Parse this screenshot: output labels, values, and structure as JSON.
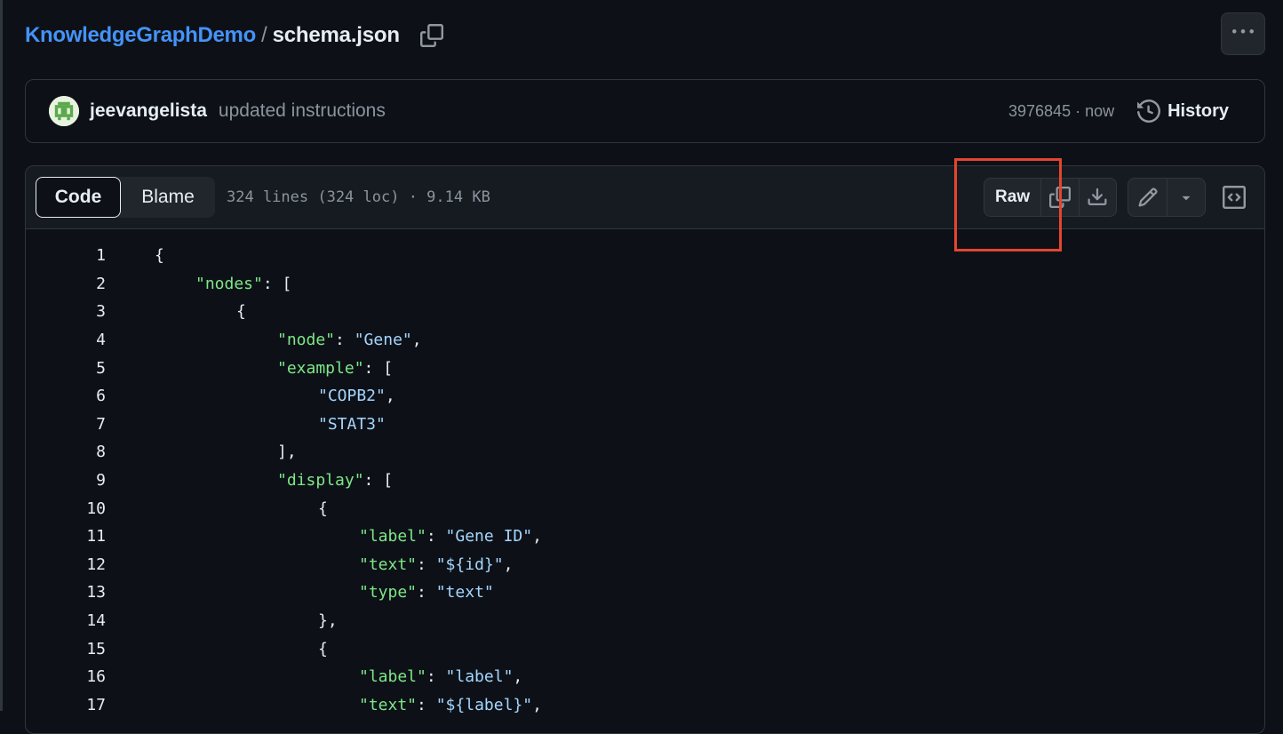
{
  "breadcrumb": {
    "repo": "KnowledgeGraphDemo",
    "separator": "/",
    "file": "schema.json",
    "copy_icon": "copy-icon"
  },
  "more_icon": "kebab-horizontal-icon",
  "commit": {
    "author": "jeevangelista",
    "message": "updated instructions",
    "sha_time": "3976845 · now",
    "history_label": "History"
  },
  "file_header": {
    "tabs": [
      "Code",
      "Blame"
    ],
    "active_tab": "Code",
    "info": "324 lines (324 loc) · 9.14 KB",
    "raw_label": "Raw",
    "icons": [
      "copy-icon",
      "download-icon",
      "pencil-icon",
      "triangle-down-icon",
      "code-square-icon"
    ]
  },
  "colors": {
    "background": "#0d1117",
    "accent": "#4493f8",
    "json_key": "#7ee787",
    "json_string": "#a5d6ff",
    "annotation_box": "#e5452e"
  },
  "code_lines": [
    {
      "n": "1",
      "indent": 0,
      "parts": [
        [
          "p",
          "{"
        ]
      ]
    },
    {
      "n": "2",
      "indent": 1,
      "parts": [
        [
          "k",
          "\"nodes\""
        ],
        [
          "p",
          ": ["
        ]
      ]
    },
    {
      "n": "3",
      "indent": 2,
      "parts": [
        [
          "p",
          "{"
        ]
      ]
    },
    {
      "n": "4",
      "indent": 3,
      "parts": [
        [
          "k",
          "\"node\""
        ],
        [
          "p",
          ": "
        ],
        [
          "s",
          "\"Gene\""
        ],
        [
          "p",
          ","
        ]
      ]
    },
    {
      "n": "5",
      "indent": 3,
      "parts": [
        [
          "k",
          "\"example\""
        ],
        [
          "p",
          ": ["
        ]
      ]
    },
    {
      "n": "6",
      "indent": 4,
      "parts": [
        [
          "s",
          "\"COPB2\""
        ],
        [
          "p",
          ","
        ]
      ]
    },
    {
      "n": "7",
      "indent": 4,
      "parts": [
        [
          "s",
          "\"STAT3\""
        ]
      ]
    },
    {
      "n": "8",
      "indent": 3,
      "parts": [
        [
          "p",
          "],"
        ]
      ]
    },
    {
      "n": "9",
      "indent": 3,
      "parts": [
        [
          "k",
          "\"display\""
        ],
        [
          "p",
          ": ["
        ]
      ]
    },
    {
      "n": "10",
      "indent": 4,
      "parts": [
        [
          "p",
          "{"
        ]
      ]
    },
    {
      "n": "11",
      "indent": 5,
      "parts": [
        [
          "k",
          "\"label\""
        ],
        [
          "p",
          ": "
        ],
        [
          "s",
          "\"Gene ID\""
        ],
        [
          "p",
          ","
        ]
      ]
    },
    {
      "n": "12",
      "indent": 5,
      "parts": [
        [
          "k",
          "\"text\""
        ],
        [
          "p",
          ": "
        ],
        [
          "s",
          "\"${id}\""
        ],
        [
          "p",
          ","
        ]
      ]
    },
    {
      "n": "13",
      "indent": 5,
      "parts": [
        [
          "k",
          "\"type\""
        ],
        [
          "p",
          ": "
        ],
        [
          "s",
          "\"text\""
        ]
      ]
    },
    {
      "n": "14",
      "indent": 4,
      "parts": [
        [
          "p",
          "},"
        ]
      ]
    },
    {
      "n": "15",
      "indent": 4,
      "parts": [
        [
          "p",
          "{"
        ]
      ]
    },
    {
      "n": "16",
      "indent": 5,
      "parts": [
        [
          "k",
          "\"label\""
        ],
        [
          "p",
          ": "
        ],
        [
          "s",
          "\"label\""
        ],
        [
          "p",
          ","
        ]
      ]
    },
    {
      "n": "17",
      "indent": 5,
      "parts": [
        [
          "k",
          "\"text\""
        ],
        [
          "p",
          ": "
        ],
        [
          "s",
          "\"${label}\""
        ],
        [
          "p",
          ","
        ]
      ]
    }
  ]
}
